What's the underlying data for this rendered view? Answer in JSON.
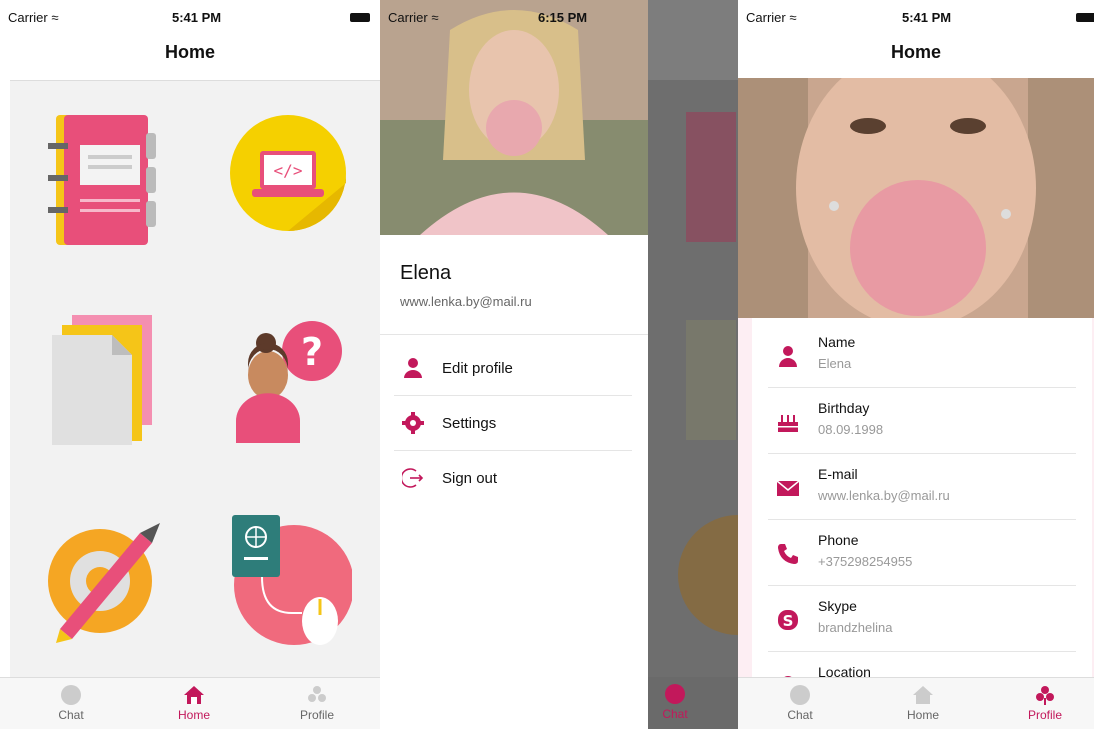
{
  "colors": {
    "accent": "#c2185b",
    "pink": "#e84f7a",
    "yellow": "#f5c518",
    "gray": "#8a8a8a"
  },
  "screen1": {
    "status": {
      "carrier": "Carrier",
      "time": "5:41 PM"
    },
    "title": "Home",
    "icons": [
      "notebook-icon",
      "code-laptop-icon",
      "documents-icon",
      "question-person-icon",
      "pencil-gear-icon",
      "passport-mouse-icon"
    ],
    "tabs": [
      {
        "label": "Chat",
        "icon": "chat-icon"
      },
      {
        "label": "Home",
        "icon": "home-icon"
      },
      {
        "label": "Profile",
        "icon": "profile-icon"
      }
    ],
    "active_tab": "Home"
  },
  "screen2": {
    "status": {
      "carrier": "Carrier",
      "time": "6:15 PM"
    },
    "user": {
      "name": "Elena",
      "email": "www.lenka.by@mail.ru"
    },
    "menu": [
      {
        "label": "Edit profile",
        "icon": "person-icon"
      },
      {
        "label": "Settings",
        "icon": "gear-icon"
      },
      {
        "label": "Sign out",
        "icon": "sign-out-icon"
      }
    ],
    "dim_tab": "Chat"
  },
  "screen3": {
    "status": {
      "carrier": "Carrier",
      "time": "5:41 PM"
    },
    "title": "Home",
    "fields": [
      {
        "label": "Name",
        "value": "Elena",
        "icon": "person-icon"
      },
      {
        "label": "Birthday",
        "value": "08.09.1998",
        "icon": "cake-icon"
      },
      {
        "label": "E-mail",
        "value": "www.lenka.by@mail.ru",
        "icon": "mail-icon"
      },
      {
        "label": "Phone",
        "value": "+375298254955",
        "icon": "phone-icon"
      },
      {
        "label": "Skype",
        "value": "brandzhelina",
        "icon": "skype-icon"
      },
      {
        "label": "Location",
        "value": "",
        "icon": "location-icon"
      }
    ],
    "tabs": [
      {
        "label": "Chat",
        "icon": "chat-icon"
      },
      {
        "label": "Home",
        "icon": "home-icon"
      },
      {
        "label": "Profile",
        "icon": "profile-icon"
      }
    ],
    "active_tab": "Profile"
  }
}
